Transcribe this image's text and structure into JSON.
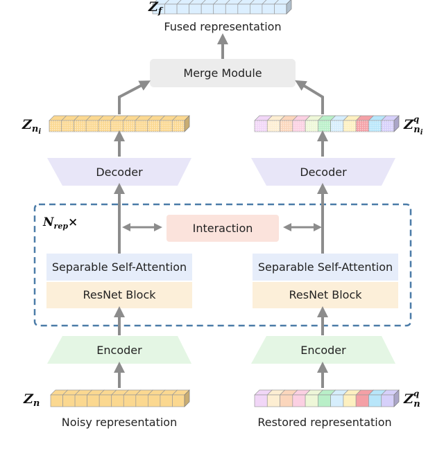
{
  "top": {
    "symbol": "Z",
    "subscript": "f",
    "label": "Fused representation",
    "colors": [
      "#dcefff"
    ]
  },
  "merge": {
    "label": "Merge Module",
    "color": "#ececec"
  },
  "left": {
    "symbol": "Z",
    "subscript": "n",
    "subsub": "i",
    "decoder": "Decoder",
    "attention": "Separable Self-Attention",
    "resnet": "ResNet Block",
    "encoder": "Encoder",
    "input_symbol": "Z",
    "input_subscript": "n",
    "input_label": "Noisy representation",
    "colors": [
      "#fbd890"
    ]
  },
  "right": {
    "symbol": "Z",
    "superscript": "q",
    "subscript": "n",
    "subsub": "i",
    "decoder": "Decoder",
    "attention": "Separable Self-Attention",
    "resnet": "ResNet Block",
    "encoder": "Encoder",
    "input_symbol": "Z",
    "input_superscript": "q",
    "input_subscript": "n",
    "input_label": "Restored representation",
    "colors": [
      "#f1d6f7",
      "#fdeed2",
      "#fbd6bc",
      "#fbd0e2",
      "#eef7d8",
      "#b9efc8",
      "#d6eefc",
      "#fdf0c0",
      "#f4a0a6",
      "#b8e6fa",
      "#d6d0fa"
    ]
  },
  "repeat_block": {
    "symbol": "N",
    "subscript": "rep",
    "suffix": "×",
    "interaction": "Interaction"
  },
  "palette": {
    "decoder": "#e8e6f8",
    "encoder": "#e4f6e4",
    "attention": "#e6edfa",
    "resnet": "#fcefd9",
    "interaction": "#fbe3dc",
    "dashed": "#4a7ba7",
    "arrow": "#8c8c8c"
  }
}
